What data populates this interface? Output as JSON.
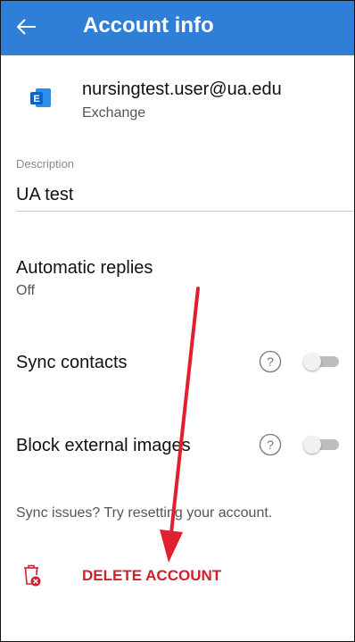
{
  "appbar": {
    "title": "Account info",
    "back_icon": "arrow-left-icon",
    "background": "#2f7fd6"
  },
  "account": {
    "email": "nursingtest.user@ua.edu",
    "type": "Exchange",
    "icon": "exchange-icon",
    "icon_color": "#0a64c9"
  },
  "description": {
    "label": "Description",
    "value": "UA test"
  },
  "automatic_replies": {
    "label": "Automatic replies",
    "value": "Off"
  },
  "sync_contacts": {
    "label": "Sync contacts",
    "enabled": false,
    "help_icon": "help-circle-icon"
  },
  "block_external_images": {
    "label": "Block external images",
    "enabled": false,
    "help_icon": "help-circle-icon"
  },
  "sync_issues_text": "Sync issues? Try resetting your account.",
  "delete_account": {
    "label": "DELETE ACCOUNT",
    "icon": "trash-x-icon",
    "color": "#d0202e"
  },
  "annotation": {
    "type": "red-arrow",
    "color": "#e02030"
  }
}
